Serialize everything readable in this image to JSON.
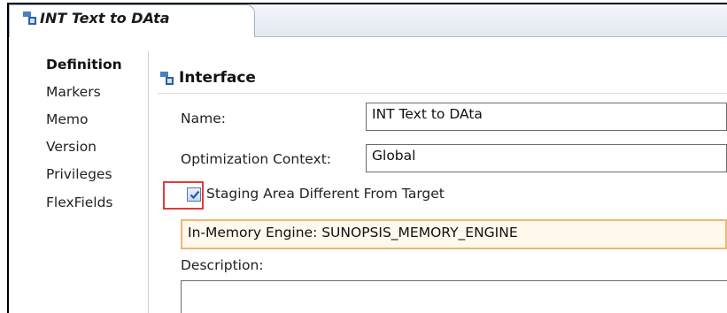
{
  "tab": {
    "title": "INT Text to DAta",
    "icon": "interface-icon"
  },
  "sidebar": {
    "items": [
      {
        "label": "Definition",
        "active": true
      },
      {
        "label": "Markers"
      },
      {
        "label": "Memo"
      },
      {
        "label": "Version"
      },
      {
        "label": "Privileges"
      },
      {
        "label": "FlexFields"
      }
    ]
  },
  "section": {
    "title": "Interface",
    "icon": "interface-icon"
  },
  "form": {
    "name_label": "Name:",
    "name_value": "INT Text to DAta",
    "context_label": "Optimization Context:",
    "context_value": "Global",
    "staging_label": "Staging Area Different From Target",
    "staging_checked": true,
    "engine_value": "In-Memory Engine:  SUNOPSIS_MEMORY_ENGINE",
    "description_label": "Description:",
    "description_value": ""
  },
  "colors": {
    "highlight_border": "#e23a3a",
    "engine_field_border": "#e8b874",
    "engine_field_bg": "#fff8ec"
  }
}
